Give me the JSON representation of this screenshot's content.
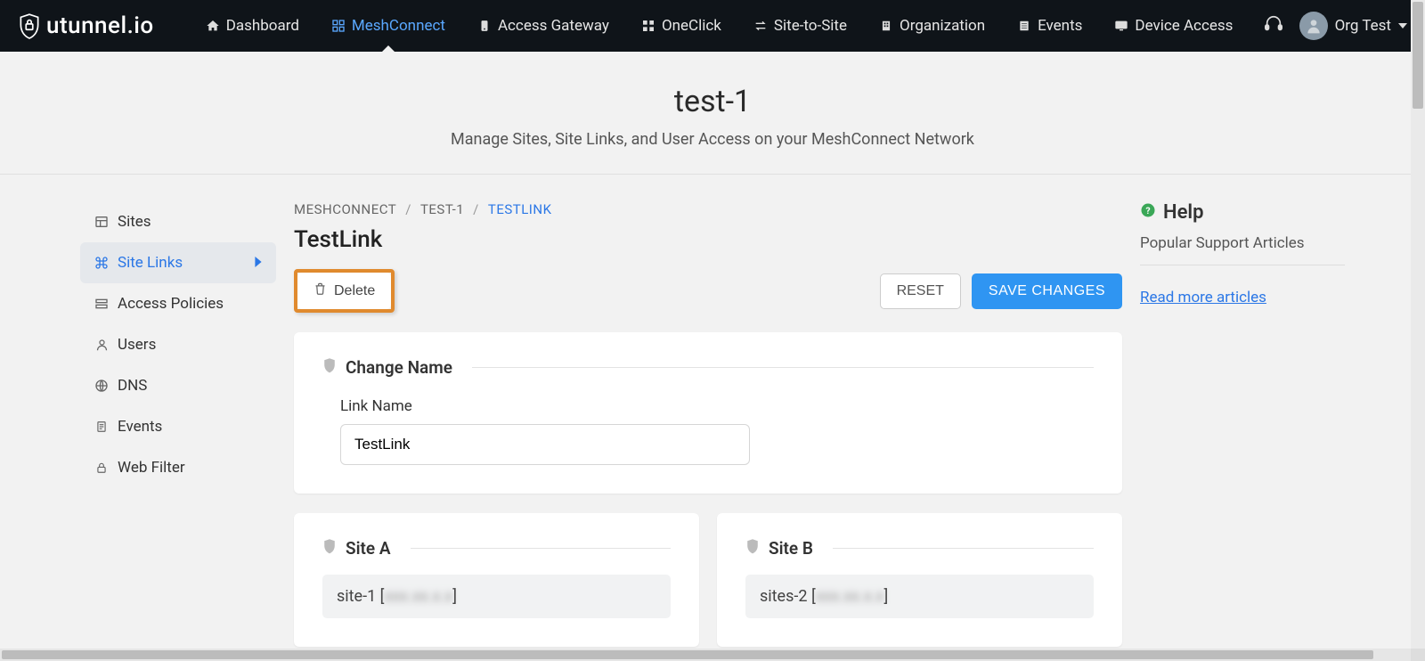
{
  "brand": "utunnel.io",
  "nav": {
    "items": [
      {
        "label": "Dashboard"
      },
      {
        "label": "MeshConnect"
      },
      {
        "label": "Access Gateway"
      },
      {
        "label": "OneClick"
      },
      {
        "label": "Site-to-Site"
      },
      {
        "label": "Organization"
      },
      {
        "label": "Events"
      },
      {
        "label": "Device Access"
      }
    ],
    "user_label": "Org Test"
  },
  "header": {
    "title": "test-1",
    "subtitle": "Manage Sites, Site Links, and User Access on your MeshConnect Network"
  },
  "sidebar": {
    "items": [
      {
        "label": "Sites"
      },
      {
        "label": "Site Links"
      },
      {
        "label": "Access Policies"
      },
      {
        "label": "Users"
      },
      {
        "label": "DNS"
      },
      {
        "label": "Events"
      },
      {
        "label": "Web Filter"
      }
    ]
  },
  "breadcrumb": {
    "a": "MESHCONNECT",
    "b": "TEST-1",
    "c": "TESTLINK"
  },
  "content": {
    "title": "TestLink",
    "delete_label": "Delete",
    "reset_label": "RESET",
    "save_label": "SAVE CHANGES",
    "change_name_heading": "Change Name",
    "link_name_label": "Link Name",
    "link_name_value": "TestLink",
    "site_a_heading": "Site A",
    "site_b_heading": "Site B",
    "site_a_value_prefix": "site-1 [",
    "site_b_value_prefix": "sites-2 [",
    "masked_suffix": "xxx.xx.x.x",
    "close_bracket": "]"
  },
  "help": {
    "heading": "Help",
    "sub": "Popular Support Articles",
    "link": "Read more articles"
  }
}
